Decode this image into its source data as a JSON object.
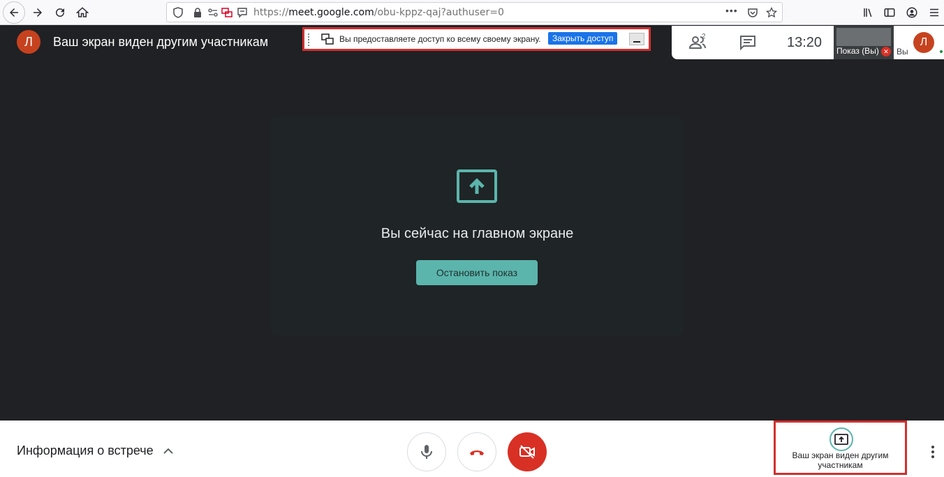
{
  "browser": {
    "url_prefix": "https://",
    "url_domain": "meet.google.com",
    "url_path": "/obu-kppz-qaj?authuser=0",
    "url_more": "•••"
  },
  "header": {
    "avatar_letter": "Л",
    "title": "Ваш экран виден другим участникам"
  },
  "share_banner": {
    "text": "Вы предоставляете доступ ко всему своему экрану.",
    "stop_label": "Закрыть доступ"
  },
  "right_panel": {
    "participants_count": "2",
    "time": "13:20",
    "thumb_label": "Показ  (Вы)",
    "self_label": "Вы",
    "avatar_letter": "Л"
  },
  "card": {
    "title": "Вы сейчас на главном экране",
    "stop_button": "Остановить показ"
  },
  "bottom": {
    "meeting_info": "Информация о встрече",
    "present_label": "Ваш экран виден другим участникам"
  },
  "colors": {
    "accent": "#5bb5ac",
    "danger": "#d93025",
    "highlight": "#d32f2f",
    "avatar": "#c6421f"
  }
}
